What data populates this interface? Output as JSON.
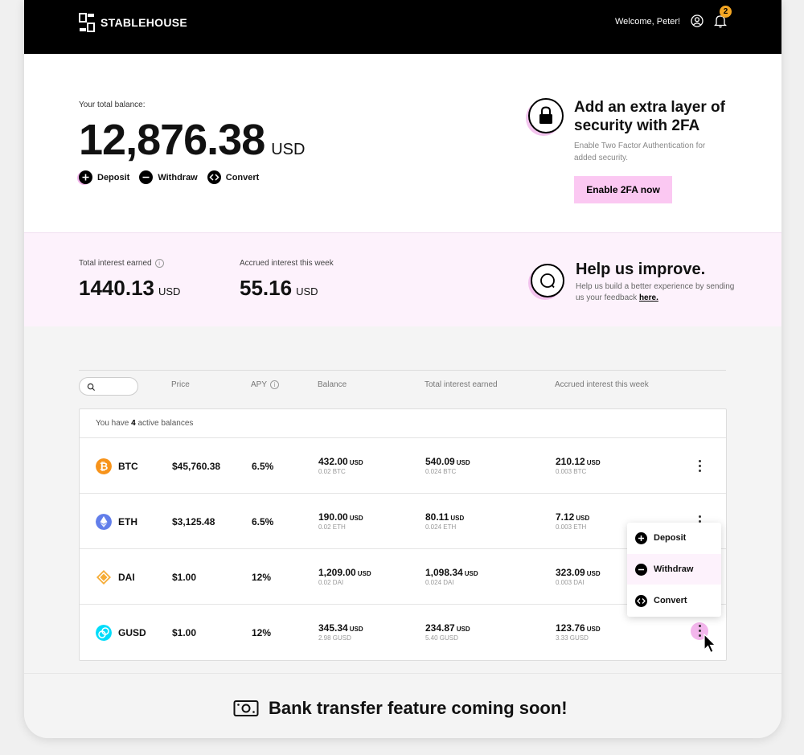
{
  "header": {
    "brand": "STABLEHOUSE",
    "welcome": "Welcome, Peter!",
    "notification_count": "2"
  },
  "balance": {
    "label": "Your total balance:",
    "value": "12,876.38",
    "unit": "USD",
    "actions": [
      "Deposit",
      "Withdraw",
      "Convert"
    ]
  },
  "security": {
    "title": "Add an extra layer of security with 2FA",
    "description": "Enable Two Factor Authentication for added security.",
    "button": "Enable 2FA now"
  },
  "interest": {
    "total_label": "Total interest earned",
    "total_value": "1440.13",
    "total_unit": "USD",
    "weekly_label": "Accrued interest this week",
    "weekly_value": "55.16",
    "weekly_unit": "USD"
  },
  "feedback": {
    "title": "Help us improve.",
    "description": "Help us build a better experience by sending us your feedback",
    "link": "here."
  },
  "table": {
    "headers": [
      "Price",
      "APY",
      "Balance",
      "Total interest earned",
      "Accrued interest this week"
    ],
    "active_prefix": "You have",
    "active_count": "4",
    "active_suffix": "active balances",
    "rows": [
      {
        "symbol": "BTC",
        "price": "$45,760.38",
        "apy": "6.5%",
        "balance": "432.00",
        "balance_unit": "USD",
        "balance_sub": "0.02 BTC",
        "total": "540.09",
        "total_unit": "USD",
        "total_sub": "0.024 BTC",
        "weekly": "210.12",
        "weekly_unit": "USD",
        "weekly_sub": "0.003 BTC",
        "color": "#f7931a"
      },
      {
        "symbol": "ETH",
        "price": "$3,125.48",
        "apy": "6.5%",
        "balance": "190.00",
        "balance_unit": "USD",
        "balance_sub": "0.02 ETH",
        "total": "80.11",
        "total_unit": "USD",
        "total_sub": "0.024 ETH",
        "weekly": "7.12",
        "weekly_unit": "USD",
        "weekly_sub": "0.003 ETH",
        "color": "#627eea"
      },
      {
        "symbol": "DAI",
        "price": "$1.00",
        "apy": "12%",
        "balance": "1,209.00",
        "balance_unit": "USD",
        "balance_sub": "0.02 DAI",
        "total": "1,098.34",
        "total_unit": "USD",
        "total_sub": "0.024 DAI",
        "weekly": "323.09",
        "weekly_unit": "USD",
        "weekly_sub": "0.003 DAI",
        "color": "#f5ac37"
      },
      {
        "symbol": "GUSD",
        "price": "$1.00",
        "apy": "12%",
        "balance": "345.34",
        "balance_unit": "USD",
        "balance_sub": "2.98 GUSD",
        "total": "234.87",
        "total_unit": "USD",
        "total_sub": "5.40 GUSD",
        "weekly": "123.76",
        "weekly_unit": "USD",
        "weekly_sub": "3.33 GUSD",
        "color": "#00dcfa"
      }
    ]
  },
  "dropdown": {
    "items": [
      "Deposit",
      "Withdraw",
      "Convert"
    ]
  },
  "footer": {
    "text": "Bank transfer feature coming soon!"
  }
}
